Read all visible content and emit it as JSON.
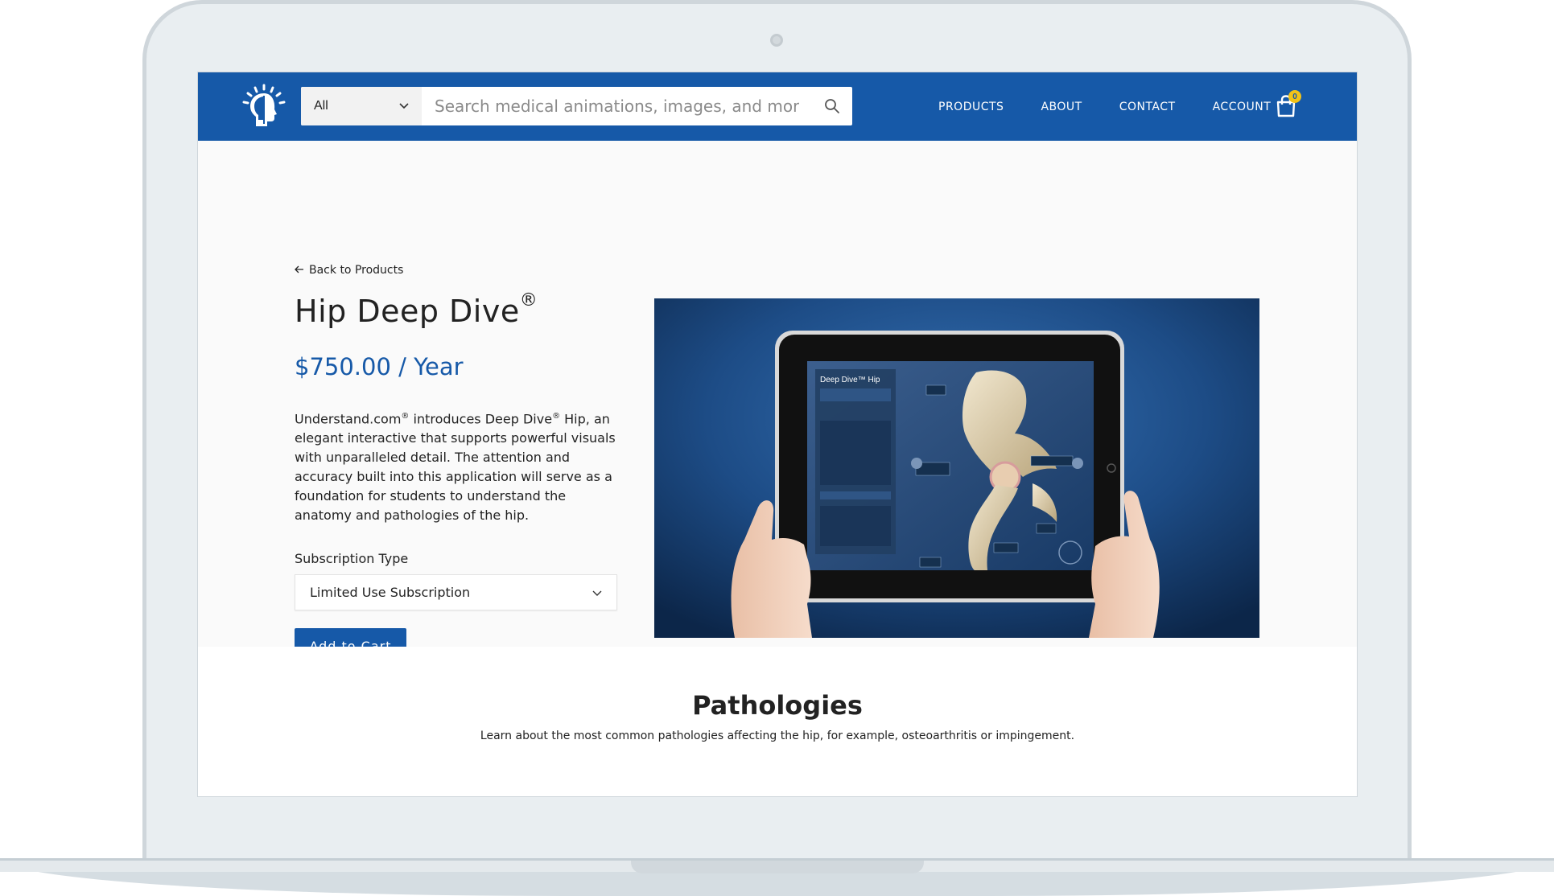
{
  "search": {
    "category": "All",
    "placeholder": "Search medical animations, images, and more"
  },
  "nav": {
    "products": "PRODUCTS",
    "about": "ABOUT",
    "contact": "CONTACT",
    "account": "ACCOUNT"
  },
  "cart": {
    "count": "0"
  },
  "product": {
    "back_link": "Back to Products",
    "title": "Hip Deep Dive",
    "title_mark": "®",
    "price": "$750.00 / Year",
    "description": {
      "brand": "Understand.com",
      "mark1": "®",
      "part1": " introduces Deep Dive",
      "mark2": "®",
      "part2": " Hip, an elegant interactive that supports powerful visuals with unparalleled detail. The attention and accuracy built into this application will serve as a foundation for students to understand the anatomy and pathologies of the hip."
    },
    "subscription_label": "Subscription Type",
    "subscription_value": "Limited Use Subscription",
    "add_to_cart": "Add to Cart"
  },
  "pathologies": {
    "title": "Pathologies",
    "description": "Learn about the most common pathologies affecting the hip, for example, osteoarthritis or impingement."
  },
  "colors": {
    "brand_blue": "#1659a8",
    "badge_yellow": "#f2c318"
  },
  "icons": [
    "lightbulb-head-logo-icon",
    "chevron-down-icon",
    "search-icon",
    "shopping-bag-icon",
    "arrow-left-icon"
  ]
}
